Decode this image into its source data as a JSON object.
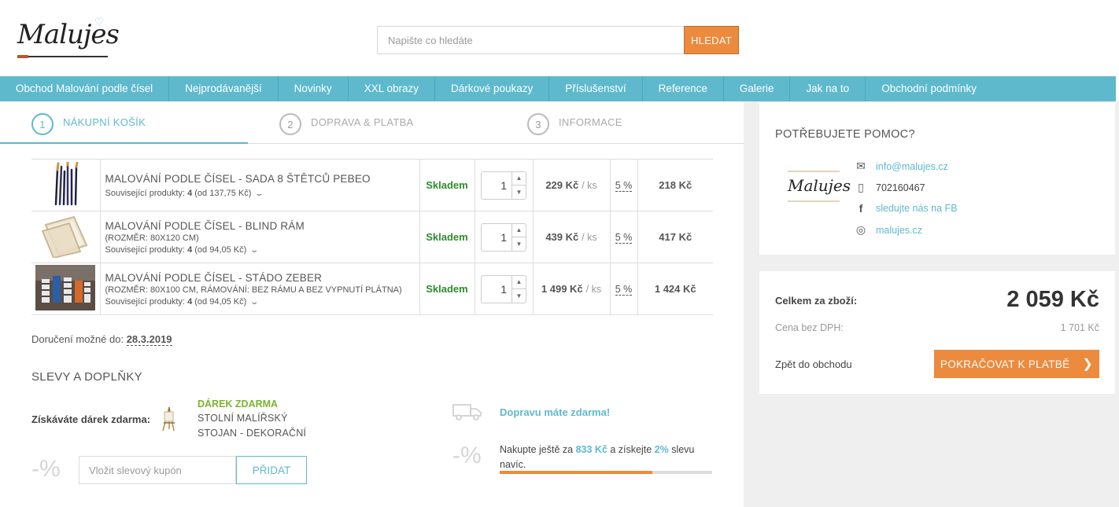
{
  "brand": {
    "logo_text": "Malujes"
  },
  "search": {
    "placeholder": "Napište co hledáte",
    "button_label": "HLEDAT"
  },
  "nav": {
    "items": [
      "Obchod Malování podle čísel",
      "Nejprodávanější",
      "Novinky",
      "XXL obrazy",
      "Dárkové poukazy",
      "Příslušenství",
      "Reference",
      "Galerie",
      "Jak na to",
      "Obchodní podmínky"
    ]
  },
  "steps": [
    {
      "num": "1",
      "label": "NÁKUPNÍ KOŠÍK"
    },
    {
      "num": "2",
      "label": "DOPRAVA & PLATBA"
    },
    {
      "num": "3",
      "label": "INFORMACE"
    }
  ],
  "cart": {
    "items": [
      {
        "title": "MALOVÁNÍ PODLE ČÍSEL - SADA 8 ŠTĚTCŮ PEBEO",
        "subtitle": "",
        "related_prefix": "Související produkty:",
        "related_count": "4",
        "related_price": "(od 137,75 Kč)",
        "stock": "Skladem",
        "qty": "1",
        "price": "229 Kč",
        "unit": "/ ks",
        "vat": "5 %",
        "total": "218 Kč",
        "image_icon": "brushes-icon"
      },
      {
        "title": "MALOVÁNÍ PODLE ČÍSEL - BLIND RÁM",
        "subtitle": "(ROZMĚR: 80X120 CM)",
        "related_prefix": "Související produkty:",
        "related_count": "4",
        "related_price": "(od 94,05 Kč)",
        "stock": "Skladem",
        "qty": "1",
        "price": "439 Kč",
        "unit": "/ ks",
        "vat": "5 %",
        "total": "417 Kč",
        "image_icon": "canvas-frame-icon"
      },
      {
        "title": "MALOVÁNÍ PODLE ČÍSEL - STÁDO ZEBER",
        "subtitle": "(ROZMĚR: 80X100 CM, RÁMOVÁNÍ: BEZ RÁMU A BEZ VYPNUTÍ PLÁTNA)",
        "related_prefix": "Související produkty:",
        "related_count": "4",
        "related_price": "(od 94,05 Kč)",
        "stock": "Skladem",
        "qty": "1",
        "price": "1 499 Kč",
        "unit": "/ ks",
        "vat": "5 %",
        "total": "1 424 Kč",
        "image_icon": "zebra-painting-icon"
      }
    ]
  },
  "delivery": {
    "label": "Doručení možné do:",
    "date": "28.3.2019"
  },
  "discounts": {
    "title": "SLEVY A DOPLŇKY",
    "gift_label": "Získáváte dárek zdarma:",
    "gift_title": "DÁREK ZDARMA",
    "gift_line1": "STOLNÍ MALÍŘSKÝ",
    "gift_line2": "STOJAN - DEKORAČNÍ",
    "percent_symbol": "-%",
    "coupon_placeholder": "Vložit slevový kupón",
    "coupon_button": "PŘIDAT",
    "free_shipping": "Dopravu máte zdarma!",
    "buy_more_1": "Nakupte ještě za ",
    "buy_more_amount": "833 Kč",
    "buy_more_2": " a získejte ",
    "buy_more_pct": "2%",
    "buy_more_3": " slevu navíc.",
    "progress": 0.72
  },
  "help": {
    "title": "POTŘEBUJETE POMOC?",
    "email": "info@malujes.cz",
    "phone": "702160467",
    "facebook": "sledujte nás na FB",
    "instagram": "malujes.cz",
    "logo_text": "Malujes"
  },
  "summary": {
    "total_label": "Celkem za zboží:",
    "total_value": "2 059 Kč",
    "net_label": "Cena bez DPH:",
    "net_value": "1 701 Kč",
    "back_label": "Zpět do obchodu",
    "pay_label": "POKRAČOVAT K PLATBĚ"
  },
  "colors": {
    "accent": "#5eb9cd",
    "orange": "#ec8a3d",
    "stock_green": "#2e8b2e",
    "gift_green": "#7ab32e"
  }
}
